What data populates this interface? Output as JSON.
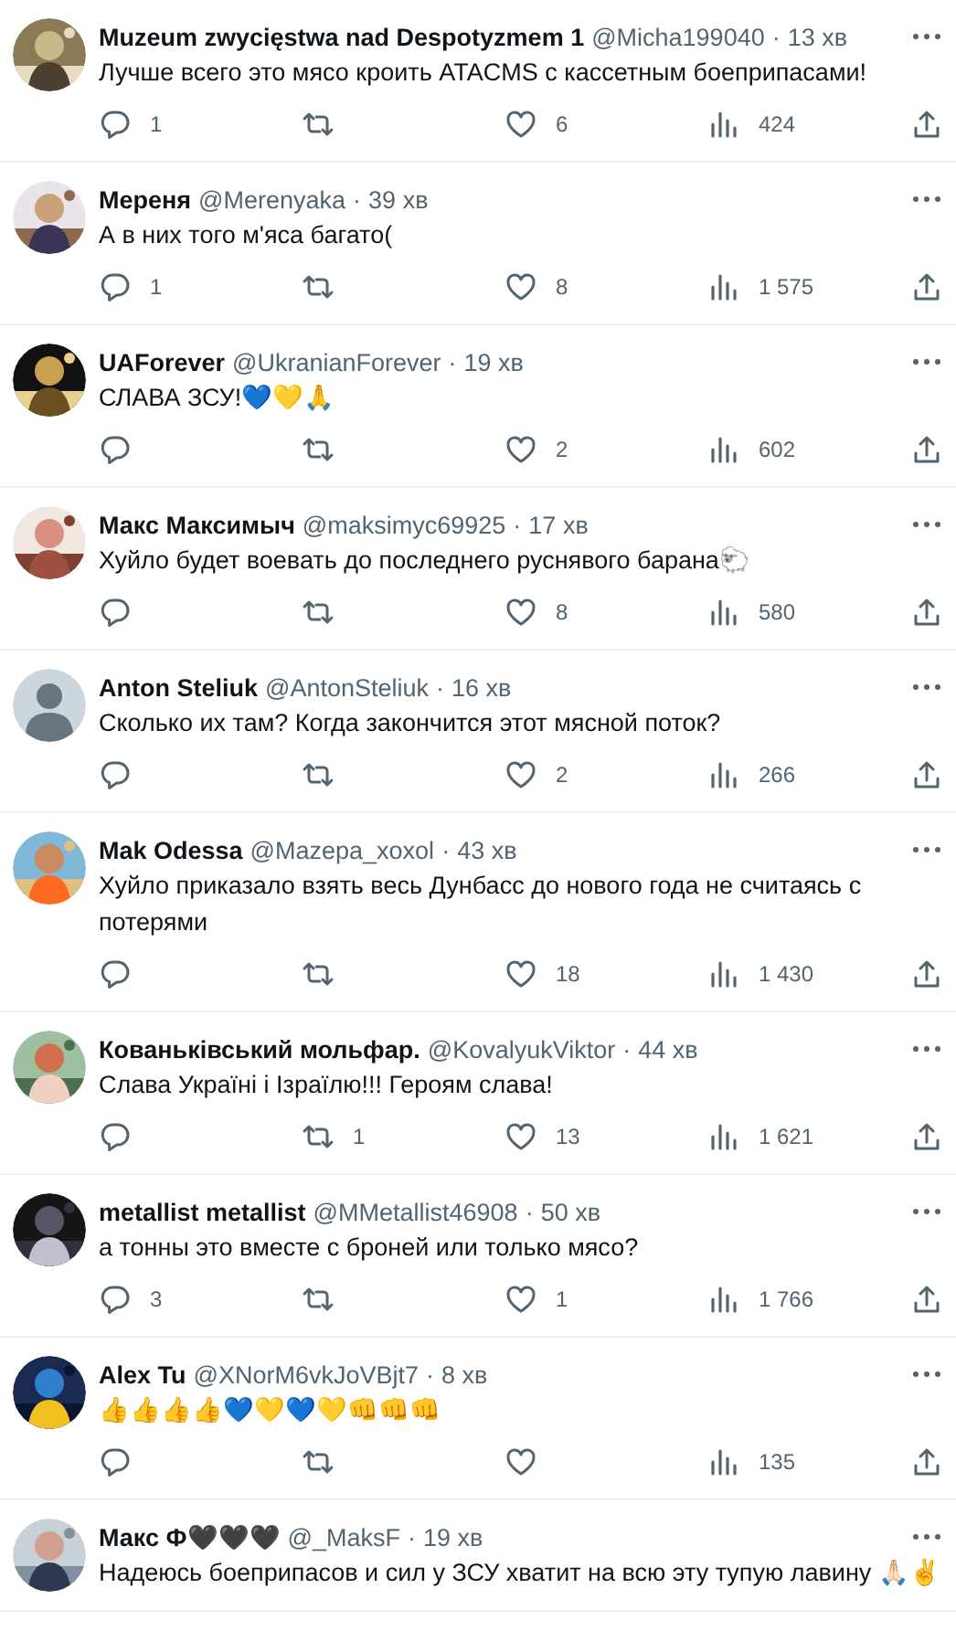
{
  "tweets": [
    {
      "name": "Muzeum zwycięstwa nad Despotyzmem 1",
      "handle": "@Micha199040",
      "separator": "·",
      "time": "13 хв",
      "text": "Лучше всего это мясо кроить ATACMS с кассетным боеприпасами!",
      "replies": "1",
      "likes": "6",
      "views": "424"
    },
    {
      "name": "Мереня",
      "handle": "@Merenyaka",
      "separator": "·",
      "time": "39 хв",
      "text": "А в них того м'яса багато(",
      "replies": "1",
      "likes": "8",
      "views": "1 575"
    },
    {
      "name": "UAForever",
      "handle": "@UkranianForever",
      "separator": "·",
      "time": "19 хв",
      "text": "СЛАВА ЗСУ!💙💛🙏",
      "likes": "2",
      "views": "602"
    },
    {
      "name": "Макс Максимыч",
      "handle": "@maksimyc69925",
      "separator": "·",
      "time": "17 хв",
      "text": "Хуйло будет воевать до последнего руснявого барана🐑",
      "likes": "8",
      "views": "580"
    },
    {
      "avatar": {
        "kind": "default"
      },
      "name": "Anton Steliuk",
      "handle": "@AntonSteliuk",
      "separator": "·",
      "time": "16 хв",
      "text": "Сколько их там? Когда закончится этот мясной поток?",
      "likes": "2",
      "views": "266"
    },
    {
      "name": "Mak Odessa",
      "handle": "@Mazepa_xoxol",
      "separator": "·",
      "time": "43 хв",
      "text": "Хуйло приказало взять весь Дунбасс до нового года не считаясь с потерями",
      "likes": "18",
      "views": "1 430"
    },
    {
      "name": "Кованьківський мольфар.",
      "handle": "@KovalyukViktor",
      "separator": "·",
      "time": "44 хв",
      "text": "Слава Україні і Ізраїлю!!! Героям слава!",
      "retweets": "1",
      "likes": "13",
      "views": "1 621"
    },
    {
      "name": "metallist metallist",
      "handle": "@MMetallist46908",
      "separator": "·",
      "time": "50 хв",
      "text": "а тонны это вместе с броней или только мясо?",
      "replies": "3",
      "likes": "1",
      "views": "1 766"
    },
    {
      "name": "Alex Tu",
      "handle": "@XNorM6vkJoVBjt7",
      "separator": "·",
      "time": "8 хв",
      "text": "👍👍👍👍💙💛💙💛👊👊👊",
      "views": "135"
    },
    {
      "name": "Макс Ф🖤🖤🖤",
      "handle": "@_MaksF",
      "separator": "·",
      "time": "19 хв",
      "text": "Надеюсь боеприпасов и сил у ЗСУ хватит на всю эту тупую лавину 🙏🏻✌️",
      "cut": true
    }
  ]
}
